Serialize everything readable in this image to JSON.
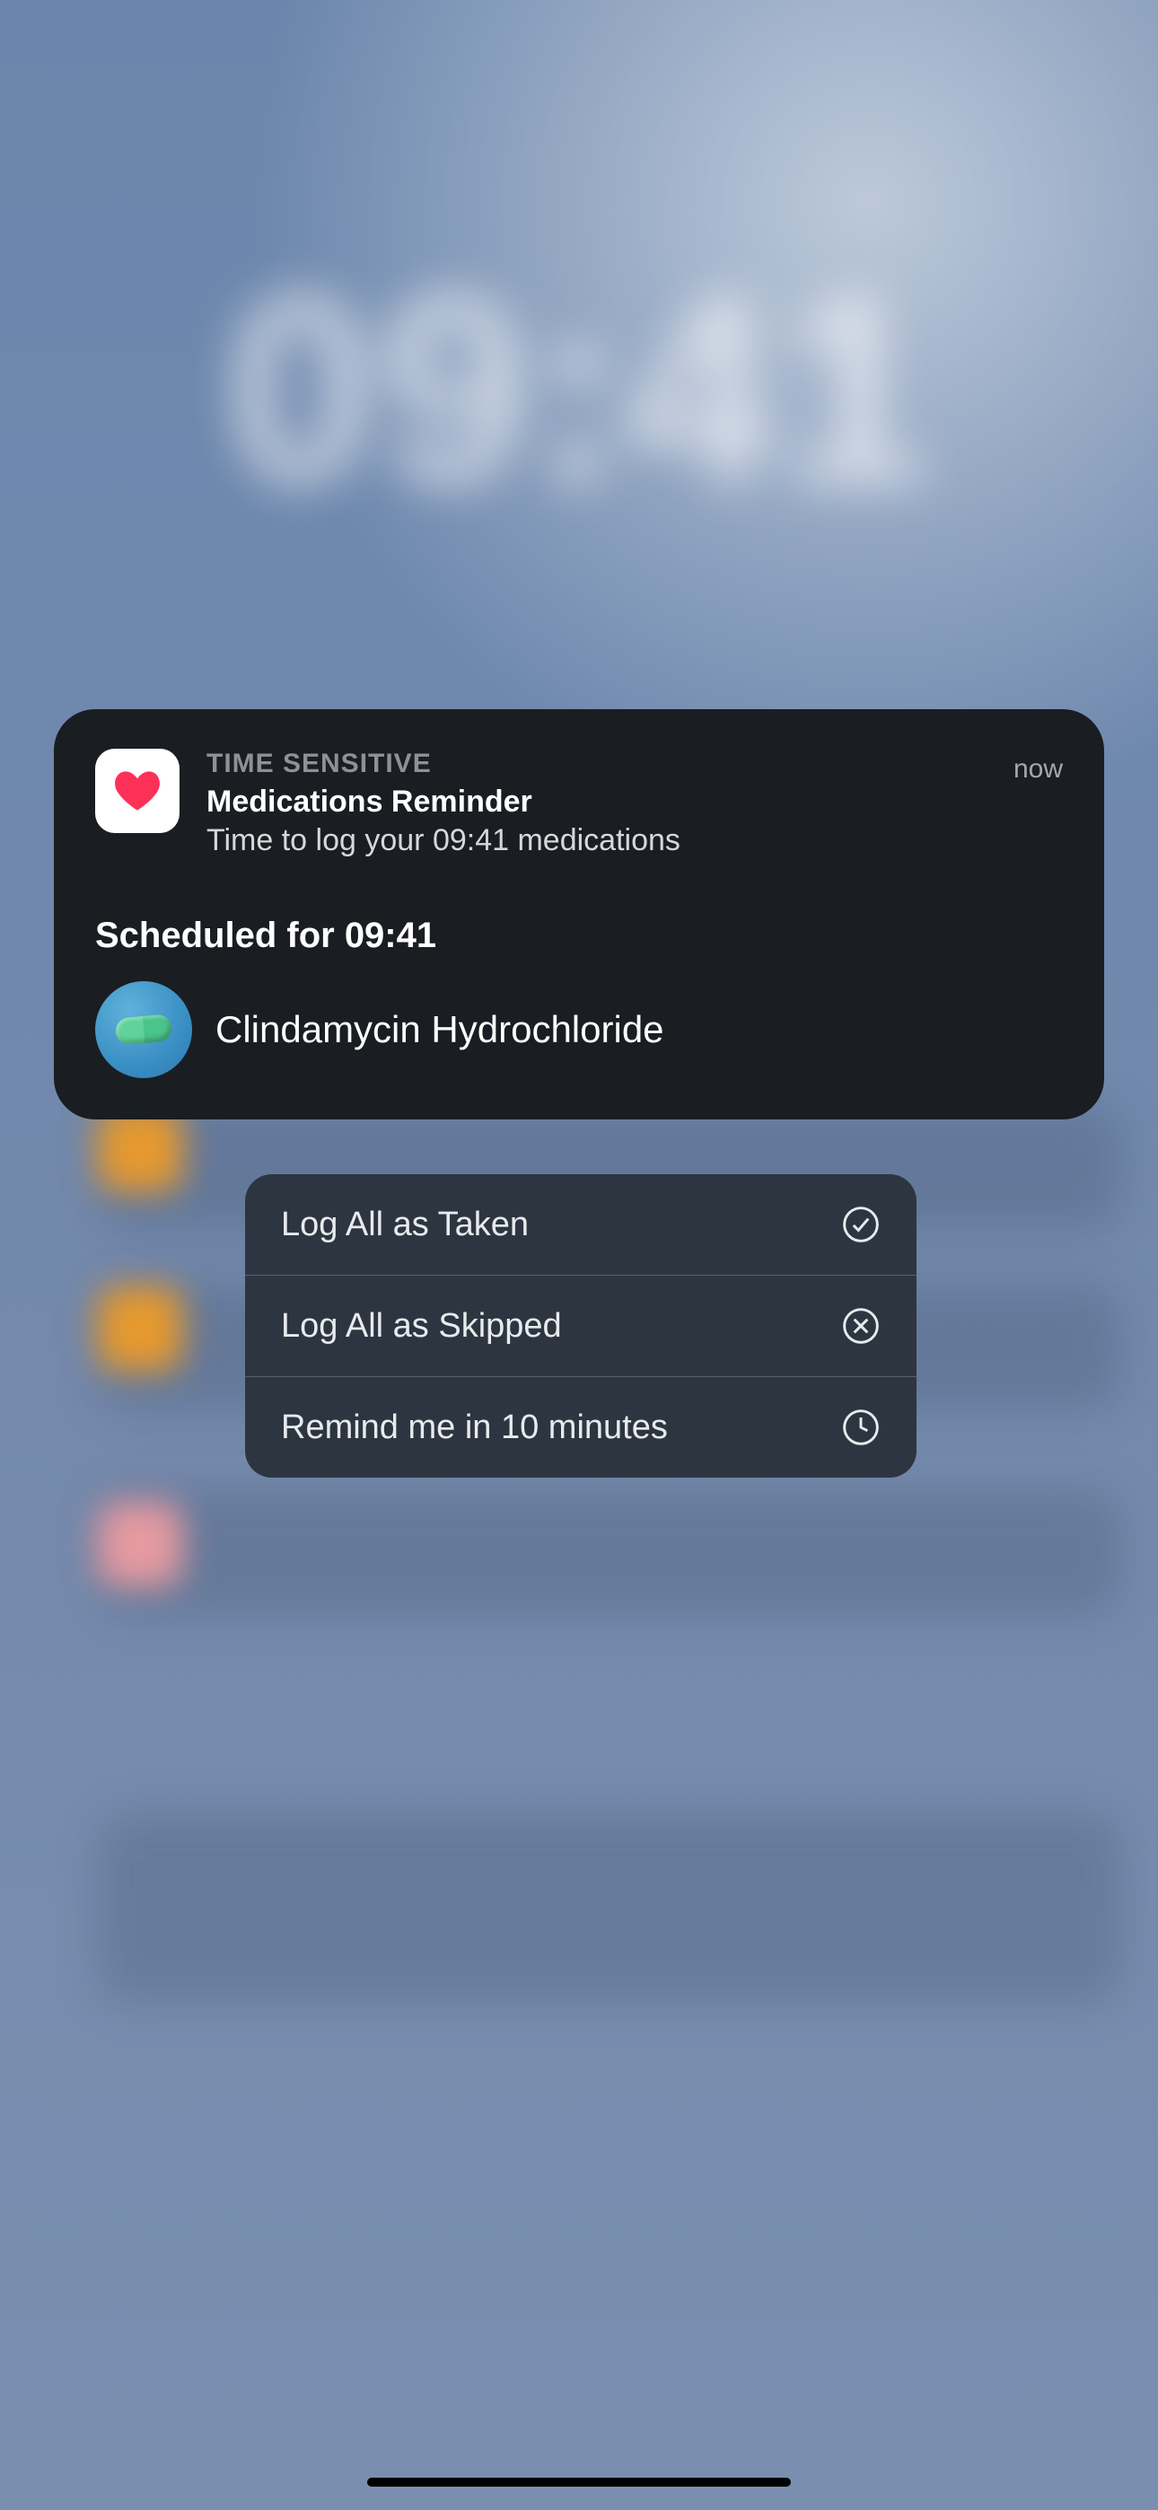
{
  "lockscreen": {
    "time": "09:41"
  },
  "notification": {
    "badge": "TIME SENSITIVE",
    "title": "Medications Reminder",
    "subtitle": "Time to log your 09:41 medications",
    "timestamp": "now",
    "scheduled": "Scheduled for 09:41",
    "medications": [
      {
        "name": "Clindamycin Hydrochloride",
        "icon": "pill-icon"
      }
    ]
  },
  "actions": [
    {
      "label": "Log All as Taken",
      "icon": "checkmark-circle-icon"
    },
    {
      "label": "Log All as Skipped",
      "icon": "x-circle-icon"
    },
    {
      "label": "Remind me in 10 minutes",
      "icon": "clock-icon"
    }
  ]
}
